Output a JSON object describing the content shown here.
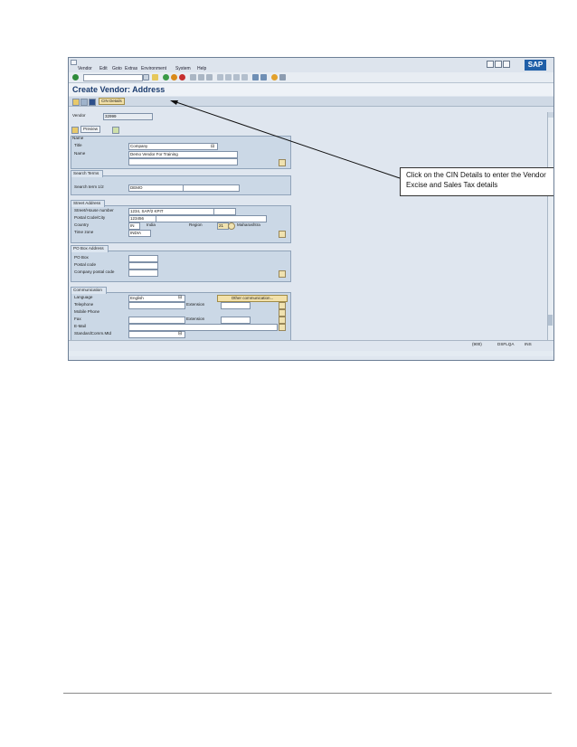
{
  "menu": [
    "Vendor",
    "Edit",
    "Goto",
    "Extras",
    "Environment",
    "System",
    "Help"
  ],
  "title": "Create Vendor: Address",
  "app_toolbar": {
    "cin_button": "CIN Details"
  },
  "vendor": {
    "label": "Vendor",
    "value": "32999"
  },
  "subtoolbar": {
    "preview": "Preview"
  },
  "name_group": {
    "title": "Name",
    "title_label": "Title",
    "title_value": "Company",
    "name_label": "Name",
    "name_value": "Demo Vendor For Training"
  },
  "search_group": {
    "title": "Search Terms",
    "label": "Search term 1/2",
    "value": "DEMO"
  },
  "street_group": {
    "title": "Street Address",
    "street_label": "Street/House number",
    "street_value": "1234, SAP/2 KPIT",
    "postal_label": "Postal Code/City",
    "postal_value": "123456",
    "country_label": "Country",
    "country_value": "IN",
    "country_name": "India",
    "region_label": "Region",
    "region_value": "21",
    "region_name": "Maharashtra",
    "tz_label": "Time zone",
    "tz_value": "INDIA"
  },
  "pobox_group": {
    "title": "PO Box Address",
    "pobox_label": "PO Box",
    "postal_label": "Postal code",
    "company_label": "Company postal code"
  },
  "comm_group": {
    "title": "Communication",
    "language_label": "Language",
    "language_value": "English",
    "other_button": "Other communication...",
    "telephone_label": "Telephone",
    "extension_label": "Extension",
    "mobile_label": "Mobile Phone",
    "fax_label": "Fax",
    "fax_ext_label": "Extension",
    "email_label": "E-Mail",
    "stdcomm_label": "StandardComm.Mtd"
  },
  "status": {
    "session": "(900)",
    "server": "DSFLQA",
    "mode": "INS"
  },
  "callout": {
    "text": "Click on the CIN Details to enter the Vendor Excise and Sales Tax details"
  },
  "colors": {
    "accent": "#1a3b6e",
    "group_bg": "#cbd8e6",
    "button_bg": "#f3e1a9",
    "sap_blue": "#1f5fa8"
  }
}
